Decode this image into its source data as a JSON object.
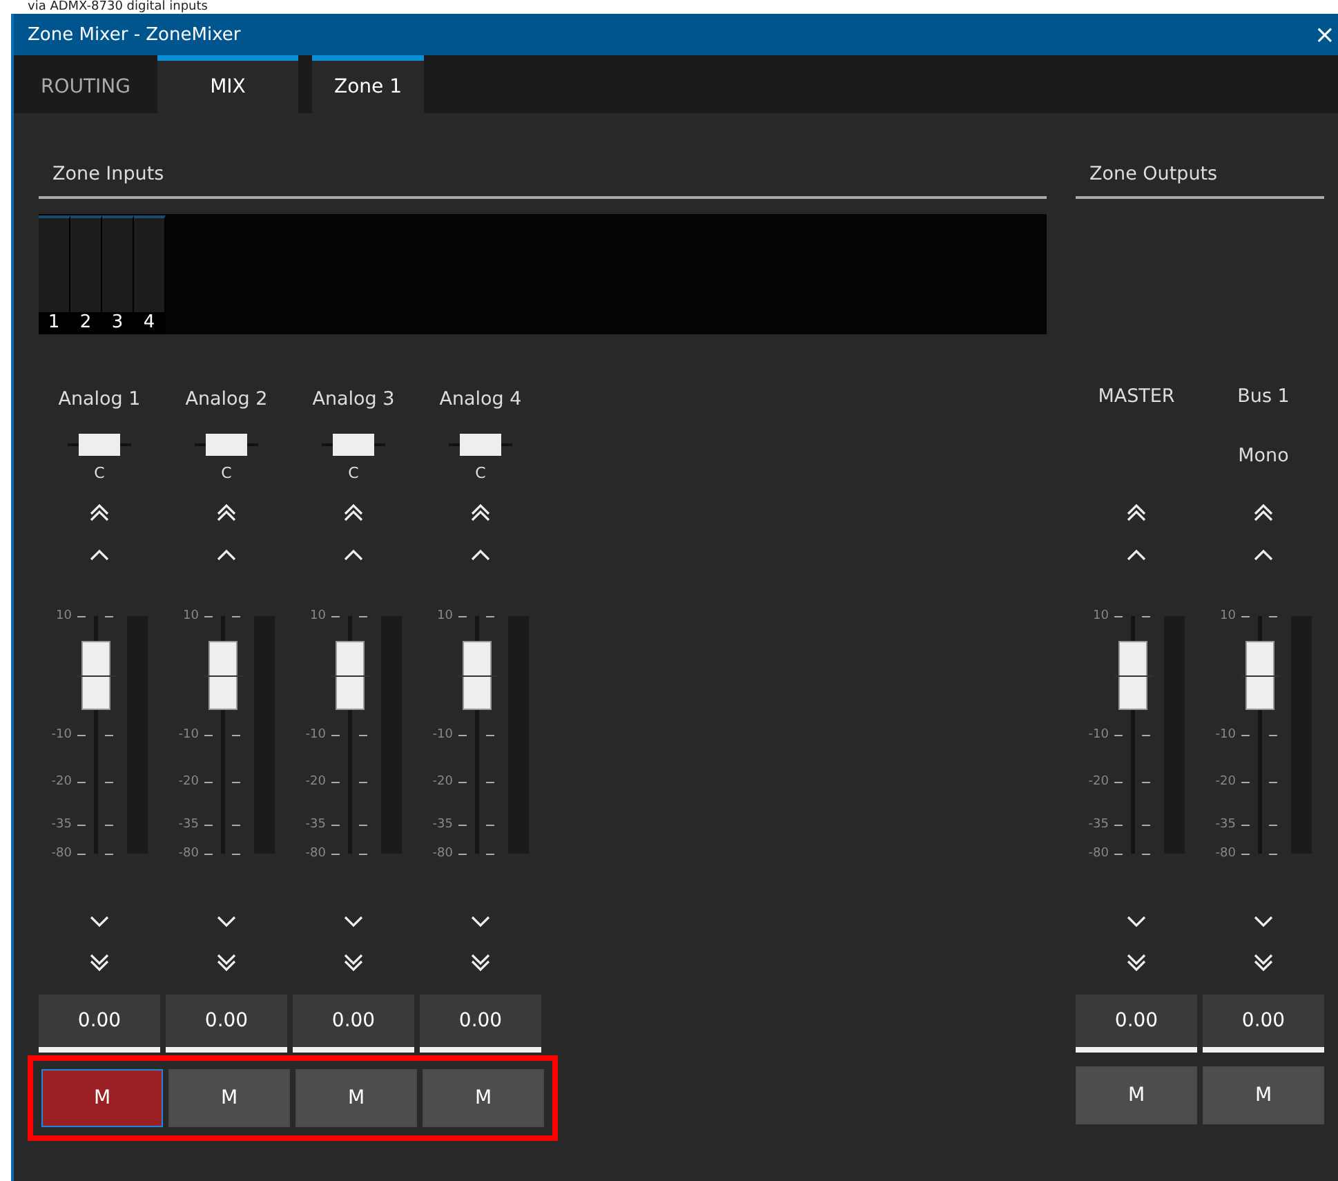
{
  "caption": "via ADMX-8730 digital inputs",
  "window": {
    "title": "Zone Mixer - ZoneMixer",
    "close": "×"
  },
  "tabs": [
    {
      "label": "ROUTING",
      "selected": false
    },
    {
      "label": "MIX",
      "selected": true
    }
  ],
  "subtabs": [
    {
      "label": "Zone 1",
      "selected": true
    }
  ],
  "inputs_header": "Zone Inputs",
  "outputs_header": "Zone Outputs",
  "meter_channels": [
    "1",
    "2",
    "3",
    "4"
  ],
  "inputs": [
    {
      "name": "Analog 1",
      "pan": {
        "level": 0.5,
        "label": "C"
      },
      "fader": {
        "level": 0.75,
        "scale": [
          "10",
          "-10",
          "-20",
          "-35",
          "-80"
        ]
      },
      "value": "0.00",
      "mute": {
        "label": "M",
        "on": true
      }
    },
    {
      "name": "Analog 2",
      "pan": {
        "level": 0.5,
        "label": "C"
      },
      "fader": {
        "level": 0.75,
        "scale": [
          "10",
          "-10",
          "-20",
          "-35",
          "-80"
        ]
      },
      "value": "0.00",
      "mute": {
        "label": "M",
        "on": false
      }
    },
    {
      "name": "Analog 3",
      "pan": {
        "level": 0.5,
        "label": "C"
      },
      "fader": {
        "level": 0.75,
        "scale": [
          "10",
          "-10",
          "-20",
          "-35",
          "-80"
        ]
      },
      "value": "0.00",
      "mute": {
        "label": "M",
        "on": false
      }
    },
    {
      "name": "Analog 4",
      "pan": {
        "level": 0.5,
        "label": "C"
      },
      "fader": {
        "level": 0.75,
        "scale": [
          "10",
          "-10",
          "-20",
          "-35",
          "-80"
        ]
      },
      "value": "0.00",
      "mute": {
        "label": "M",
        "on": false
      }
    }
  ],
  "outputs": [
    {
      "name": "MASTER",
      "fader": {
        "level": 0.75,
        "scale": [
          "10",
          "-10",
          "-20",
          "-35",
          "-80"
        ]
      },
      "value": "0.00",
      "mute": {
        "label": "M",
        "on": false
      }
    },
    {
      "name": "Bus 1",
      "mode": "Mono",
      "fader": {
        "level": 0.75,
        "scale": [
          "10",
          "-10",
          "-20",
          "-35",
          "-80"
        ]
      },
      "value": "0.00",
      "mute": {
        "label": "M",
        "on": false
      }
    }
  ],
  "highlight": {
    "on": true
  }
}
